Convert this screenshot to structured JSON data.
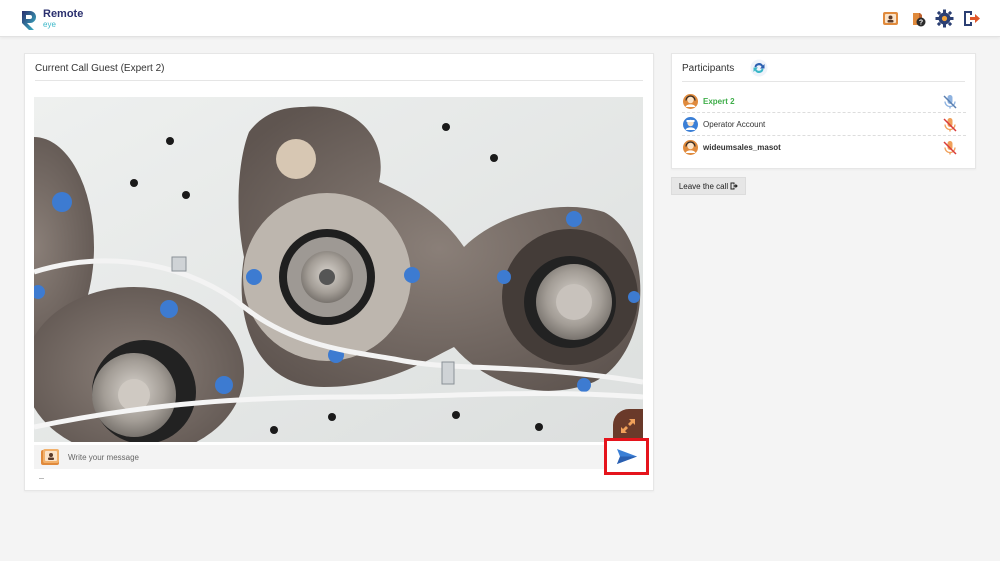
{
  "app": {
    "logo_title": "Remote",
    "logo_subtitle": "eye"
  },
  "header": {
    "icons": [
      "contact-card-icon",
      "help-icon",
      "settings-gear-icon",
      "logout-icon"
    ]
  },
  "call": {
    "title": "Current Call Guest  (Expert 2)",
    "message_placeholder": "Write your message"
  },
  "participants": {
    "title": "Participants",
    "items": [
      {
        "name": "Expert 2",
        "status": "active",
        "mic": "muted-blue"
      },
      {
        "name": "Operator Account",
        "status": "normal",
        "mic": "muted-red"
      },
      {
        "name": "wideumsales_masot",
        "status": "bold",
        "mic": "muted-red"
      }
    ]
  },
  "leave": {
    "label": "Leave the call"
  },
  "colors": {
    "active_participant": "#3fae4a",
    "highlight_border": "#e5141c",
    "send_arrow": "#3b7fd6",
    "logo_primary": "#2a2f6e",
    "logo_accent": "#3ab7c8"
  }
}
